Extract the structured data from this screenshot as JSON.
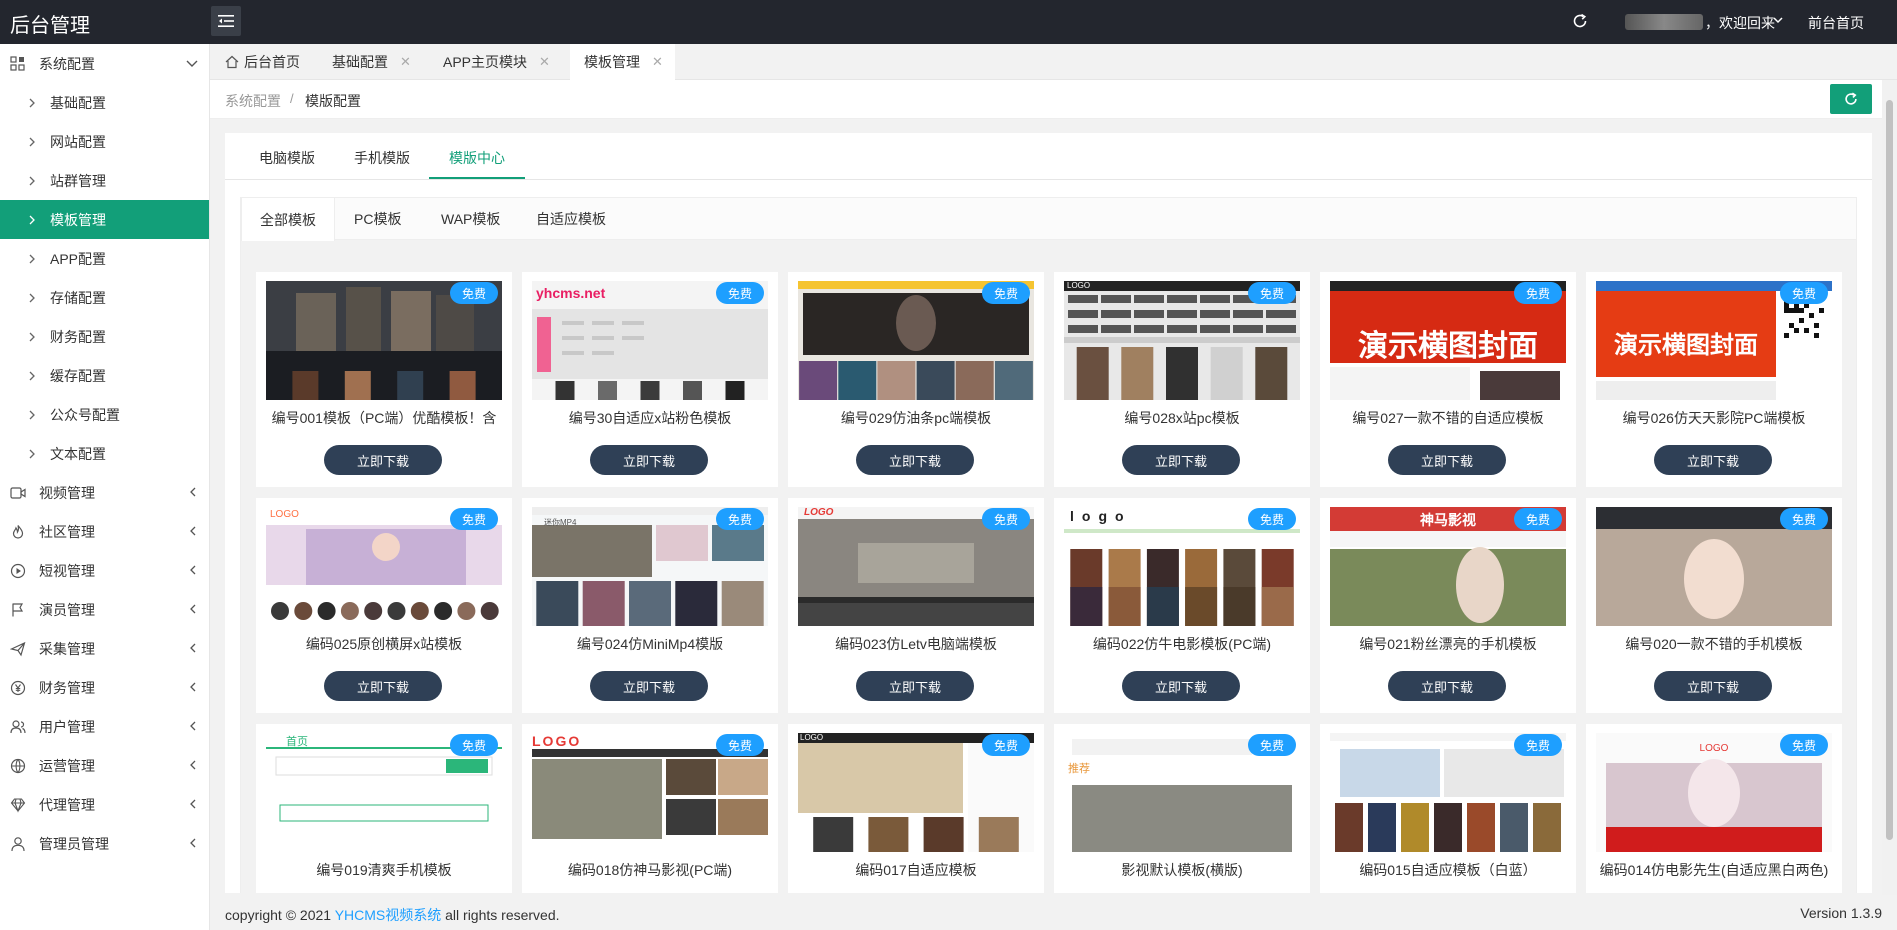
{
  "app": {
    "title": "后台管理",
    "welcome": "，欢迎回来",
    "front_home": "前台首页"
  },
  "sidebar": {
    "system_group": "系统配置",
    "system_items": [
      "基础配置",
      "网站配置",
      "站群管理",
      "模板管理",
      "APP配置",
      "存储配置",
      "财务配置",
      "缓存配置",
      "公众号配置",
      "文本配置"
    ],
    "active_item": "模板管理",
    "groups": [
      {
        "label": "视频管理",
        "icon": "video-icon"
      },
      {
        "label": "社区管理",
        "icon": "fire-icon"
      },
      {
        "label": "短视管理",
        "icon": "play-circle-icon"
      },
      {
        "label": "演员管理",
        "icon": "flag-icon"
      },
      {
        "label": "采集管理",
        "icon": "send-icon"
      },
      {
        "label": "财务管理",
        "icon": "yen-icon"
      },
      {
        "label": "用户管理",
        "icon": "users-icon"
      },
      {
        "label": "运营管理",
        "icon": "globe-icon"
      },
      {
        "label": "代理管理",
        "icon": "diamond-icon"
      },
      {
        "label": "管理员管理",
        "icon": "user-icon"
      }
    ]
  },
  "tabbar": {
    "tabs": [
      {
        "label": "后台首页",
        "closable": false
      },
      {
        "label": "基础配置",
        "closable": true
      },
      {
        "label": "APP主页模块",
        "closable": true
      },
      {
        "label": "模板管理",
        "closable": true,
        "active": true
      }
    ]
  },
  "breadcrumb": {
    "parent": "系统配置",
    "sep": "/",
    "current": "模版配置"
  },
  "main_tabs": [
    "电脑模版",
    "手机模版",
    "模版中心"
  ],
  "main_tabs_active": "模版中心",
  "sub_tabs": [
    "全部模板",
    "PC模板",
    "WAP模板",
    "自适应模板"
  ],
  "sub_tabs_active": "全部模板",
  "card_badge": "免费",
  "card_button": "立即下载",
  "templates": [
    {
      "name": "编号001模板（PC端）优酷模板！含",
      "thumb_text": ""
    },
    {
      "name": "编号30自适应x站粉色模板",
      "thumb_text": "yhcms.net"
    },
    {
      "name": "编号029仿油条pc端模板",
      "thumb_text": ""
    },
    {
      "name": "编号028x站pc模板",
      "thumb_text": "LOGO"
    },
    {
      "name": "编号027一款不错的自适应模板",
      "thumb_text": "演示横图封面"
    },
    {
      "name": "编号026仿天天影院PC端模板",
      "thumb_text": "演示横图封面"
    },
    {
      "name": "编码025原创横屏x站模板",
      "thumb_text": "LOGO"
    },
    {
      "name": "编号024仿MiniMp4模版",
      "thumb_text": "迷你MP4"
    },
    {
      "name": "编码023仿Letv电脑端模板",
      "thumb_text": "LOGO"
    },
    {
      "name": "编码022仿牛电影模板(PC端)",
      "thumb_text": "logo"
    },
    {
      "name": "编号021粉丝漂亮的手机模板",
      "thumb_text": "神马影视"
    },
    {
      "name": "编号020一款不错的手机模板",
      "thumb_text": ""
    },
    {
      "name": "编号019清爽手机模板",
      "thumb_text": "首页"
    },
    {
      "name": "编码018仿神马影视(PC端)",
      "thumb_text": "LOGO"
    },
    {
      "name": "编码017自适应模板",
      "thumb_text": "LOGO"
    },
    {
      "name": "影视默认模板(横版)",
      "thumb_text": "推荐"
    },
    {
      "name": "编码015自适应模板（白蓝）",
      "thumb_text": ""
    },
    {
      "name": "编码014仿电影先生(自适应黑白两色)",
      "thumb_text": "LOGO"
    }
  ],
  "footer": {
    "copy_prefix": "copyright © 2021 ",
    "brand": "YHCMS视频系统",
    "copy_suffix": " all rights reserved.",
    "version": "Version 1.3.9"
  },
  "colors": {
    "accent": "#129f79",
    "badge": "#1e9fff",
    "button": "#2f4056",
    "topbar": "#23262e"
  }
}
